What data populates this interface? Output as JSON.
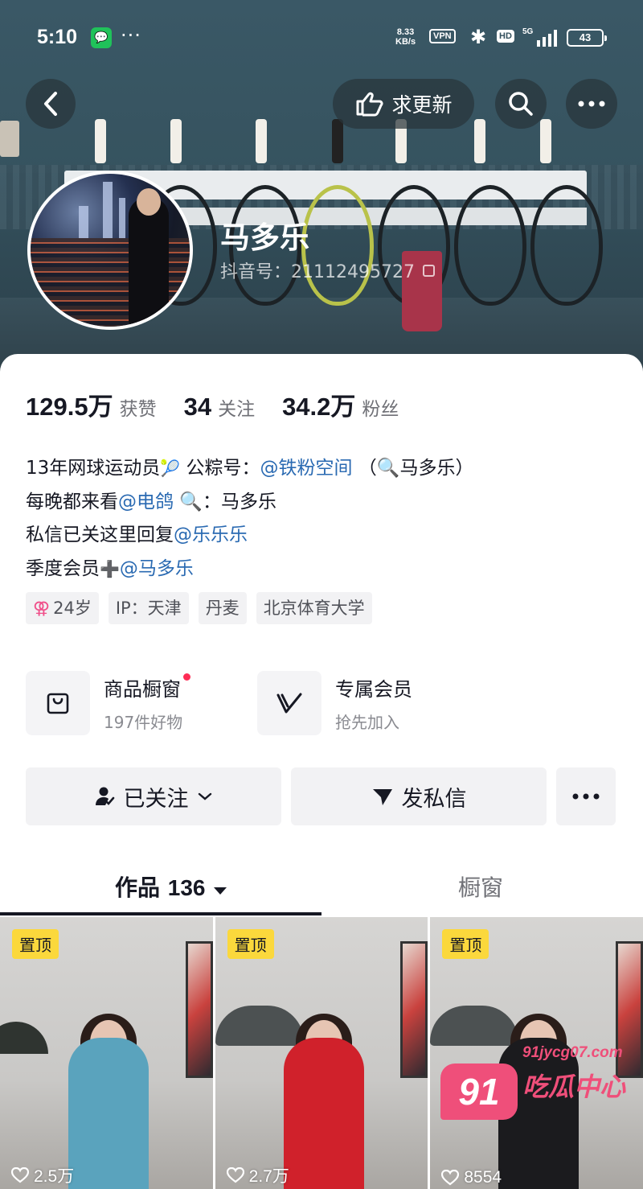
{
  "status_bar": {
    "time": "5:10",
    "net_speed": "8.33",
    "net_unit": "KB/s",
    "vpn": "VPN",
    "hd": "HD",
    "signal": "5G",
    "battery": "43"
  },
  "header": {
    "request_update_label": "求更新"
  },
  "profile": {
    "name": "马多乐",
    "douyin_id": "抖音号：21112495727"
  },
  "stats": [
    {
      "value": "129.5万",
      "label": "获赞"
    },
    {
      "value": "34",
      "label": "关注"
    },
    {
      "value": "34.2万",
      "label": "粉丝"
    }
  ],
  "bio": {
    "line1_text": "13年网球运动员",
    "line1_emoji": "🎾",
    "line1_mid": " 公粽号：",
    "line1_mention": "@铁粉空间",
    "line1_end": "  （🔍马多乐）",
    "line2_text": "每晚都来看",
    "line2_mention": "@电鸽",
    "line2_end": " 🔍：马多乐",
    "line3_text": "私信已关这里回复",
    "line3_mention": "@乐乐乐",
    "line4_text": "季度会员",
    "line4_emoji": "➕",
    "line4_mention": "@马多乐"
  },
  "tags": {
    "gender_symbol": "⚢",
    "age": "24岁",
    "ip": "IP：天津",
    "place": "丹麦",
    "school": "北京体育大学"
  },
  "services": {
    "shop_title": "商品橱窗",
    "shop_sub": "197件好物",
    "member_title": "专属会员",
    "member_sub": "抢先加入"
  },
  "actions": {
    "follow_label": "已关注",
    "dm_label": "发私信"
  },
  "tabs": {
    "works_label": "作品",
    "works_count": "136",
    "shop_label": "橱窗"
  },
  "videos": [
    {
      "pin": "置顶",
      "likes": "2.5万",
      "outfit_color": "#5aa3bd"
    },
    {
      "pin": "置顶",
      "likes": "2.7万",
      "outfit_color": "#d0212b"
    },
    {
      "pin": "置顶",
      "likes": "8554",
      "outfit_color": "#1b1b1e"
    }
  ],
  "watermark": {
    "badge": "91",
    "url": "91jycg07.com",
    "text": "吃瓜中心"
  },
  "colors": {
    "mention": "#2a6ab2",
    "notification_dot": "#fe2c55",
    "pin_badge": "#fbd83c"
  }
}
